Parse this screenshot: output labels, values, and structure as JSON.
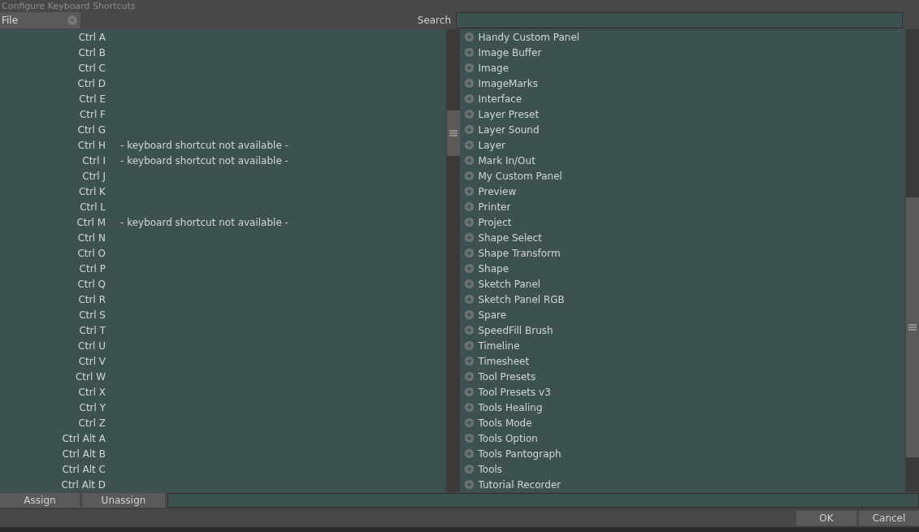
{
  "window": {
    "title": "Configure Keyboard Shortcuts"
  },
  "category": {
    "value": "File"
  },
  "search": {
    "label": "Search"
  },
  "shortcuts": [
    {
      "key": "Ctrl A"
    },
    {
      "key": "Ctrl B"
    },
    {
      "key": "Ctrl C"
    },
    {
      "key": "Ctrl D"
    },
    {
      "key": "Ctrl E"
    },
    {
      "key": "Ctrl F"
    },
    {
      "key": "Ctrl G"
    },
    {
      "key": "Ctrl H",
      "note": "- keyboard shortcut not available -"
    },
    {
      "key": "Ctrl I",
      "note": "- keyboard shortcut not available -"
    },
    {
      "key": "Ctrl J"
    },
    {
      "key": "Ctrl K"
    },
    {
      "key": "Ctrl L"
    },
    {
      "key": "Ctrl M",
      "note": "- keyboard shortcut not available -"
    },
    {
      "key": "Ctrl N"
    },
    {
      "key": "Ctrl O"
    },
    {
      "key": "Ctrl P"
    },
    {
      "key": "Ctrl Q"
    },
    {
      "key": "Ctrl R"
    },
    {
      "key": "Ctrl S"
    },
    {
      "key": "Ctrl T"
    },
    {
      "key": "Ctrl U"
    },
    {
      "key": "Ctrl V"
    },
    {
      "key": "Ctrl W"
    },
    {
      "key": "Ctrl X"
    },
    {
      "key": "Ctrl Y"
    },
    {
      "key": "Ctrl Z"
    },
    {
      "key": "Ctrl Alt A"
    },
    {
      "key": "Ctrl Alt B"
    },
    {
      "key": "Ctrl Alt C"
    },
    {
      "key": "Ctrl Alt D"
    }
  ],
  "groups": [
    "Handy Custom Panel",
    "Image Buffer",
    "Image",
    "ImageMarks",
    "Interface",
    "Layer Preset",
    "Layer Sound",
    "Layer",
    "Mark In/Out",
    "My Custom Panel",
    "Preview",
    "Printer",
    "Project",
    "Shape Select",
    "Shape Transform",
    "Shape",
    "Sketch Panel",
    "Sketch Panel RGB",
    "Spare",
    "SpeedFill Brush",
    "Timeline",
    "Timesheet",
    "Tool Presets",
    "Tool Presets v3",
    "Tools Healing",
    "Tools Mode",
    "Tools Option",
    "Tools Pantograph",
    "Tools",
    "Tutorial Recorder"
  ],
  "actions": {
    "assign": "Assign",
    "unassign": "Unassign"
  },
  "buttons": [
    "OK",
    "Cancel"
  ]
}
